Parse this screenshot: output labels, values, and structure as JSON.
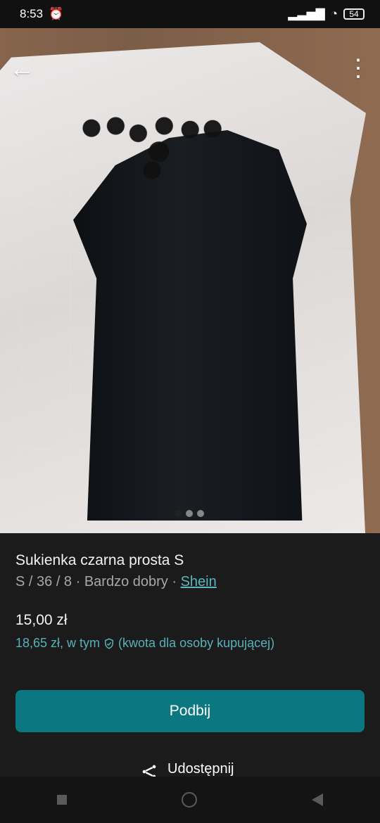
{
  "status": {
    "time": "8:53",
    "battery": "54"
  },
  "listing": {
    "title": "Sukienka czarna prosta S",
    "size": "S / 36 / 8",
    "condition": "Bardzo dobry",
    "brand": "Shein",
    "price": "15,00 zł",
    "buyer_price": "18,65 zł, w tym",
    "buyer_note": "(kwota dla osoby kupującej)"
  },
  "actions": {
    "bump": "Podbij",
    "share": "Udostępnij"
  },
  "gallery": {
    "dots": 3,
    "active_index": 1
  },
  "colors": {
    "accent": "#0b7881",
    "link": "#59b7bd"
  },
  "icons": {
    "back": "back-arrow-icon",
    "menu": "vertical-dots-icon",
    "shield": "shield-check-icon",
    "share": "share-icon"
  }
}
